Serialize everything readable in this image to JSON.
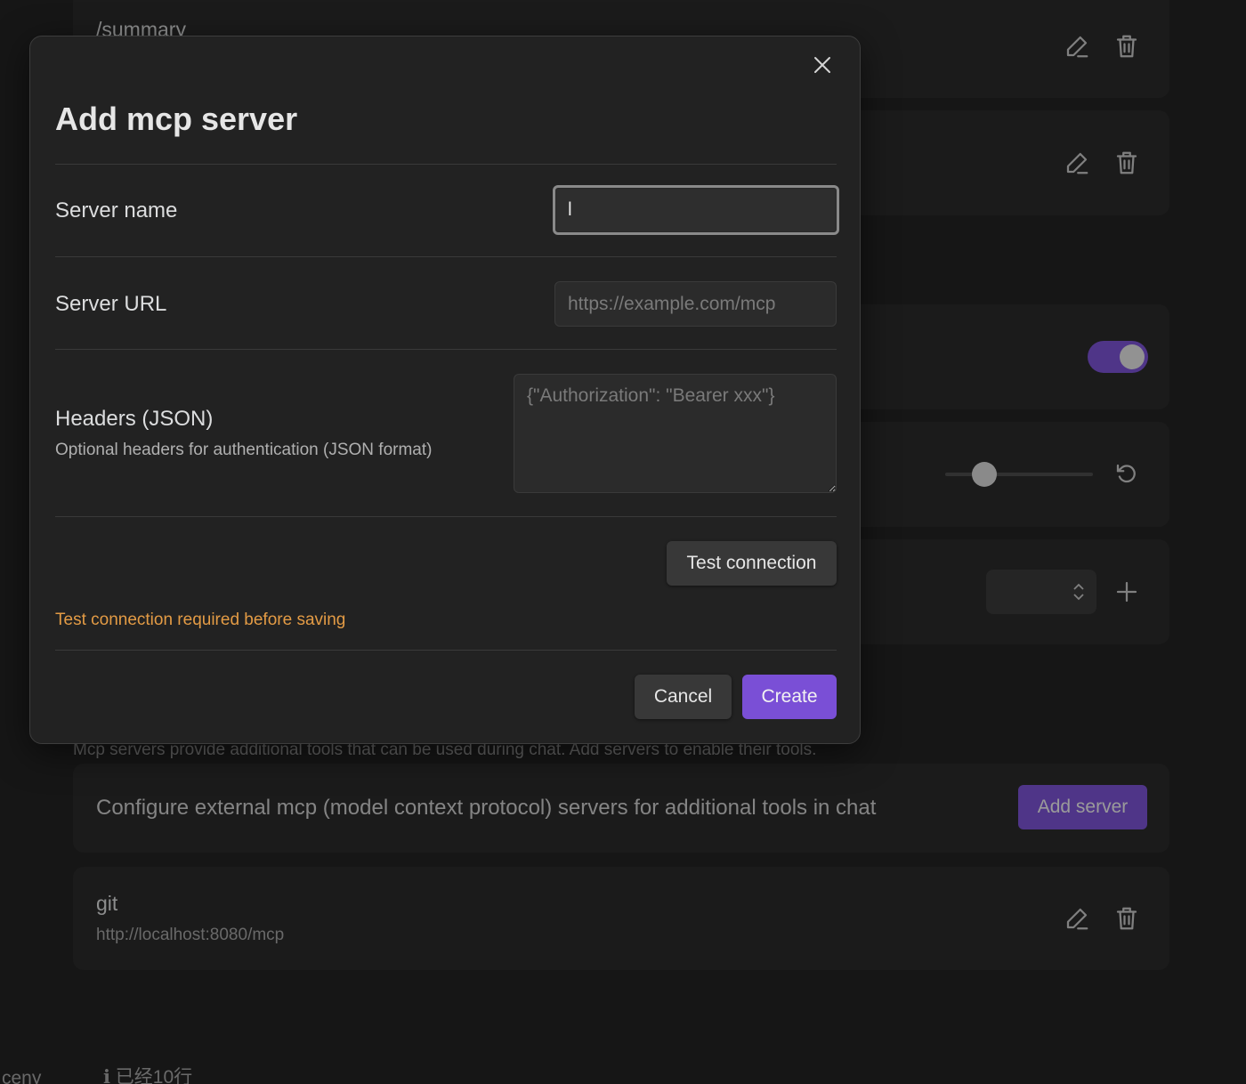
{
  "background": {
    "cards": [
      {
        "title": "/summary",
        "subtitle": ""
      }
    ],
    "mcp_section": {
      "description": "Mcp servers provide additional tools that can be used during chat. Add servers to enable their tools.",
      "config_text": "Configure external mcp (model context protocol) servers for additional tools in chat",
      "add_server_label": "Add server",
      "servers": [
        {
          "name": "git",
          "url": "http://localhost:8080/mcp"
        }
      ]
    },
    "toggle_on": true,
    "slider_value_fraction": 0.26,
    "footer_left": "ceny",
    "footer_mid": "ℹ 已经10行"
  },
  "modal": {
    "title": "Add mcp server",
    "fields": {
      "server_name": {
        "label": "Server name",
        "value": "l",
        "placeholder": ""
      },
      "server_url": {
        "label": "Server URL",
        "value": "",
        "placeholder": "https://example.com/mcp"
      },
      "headers": {
        "label": "Headers (JSON)",
        "description": "Optional headers for authentication (JSON format)",
        "placeholder": "{\"Authorization\": \"Bearer xxx\"}"
      }
    },
    "test_connection_label": "Test connection",
    "warning": "Test connection required before saving",
    "cancel_label": "Cancel",
    "create_label": "Create"
  },
  "colors": {
    "accent": "#7a4fd6",
    "warning": "#e39b45",
    "background": "#1e1e1e",
    "modal": "#222222"
  },
  "icons": [
    "close-icon",
    "pencil-icon",
    "trash-icon",
    "reset-icon",
    "plus-icon",
    "chevron-updown-icon"
  ]
}
